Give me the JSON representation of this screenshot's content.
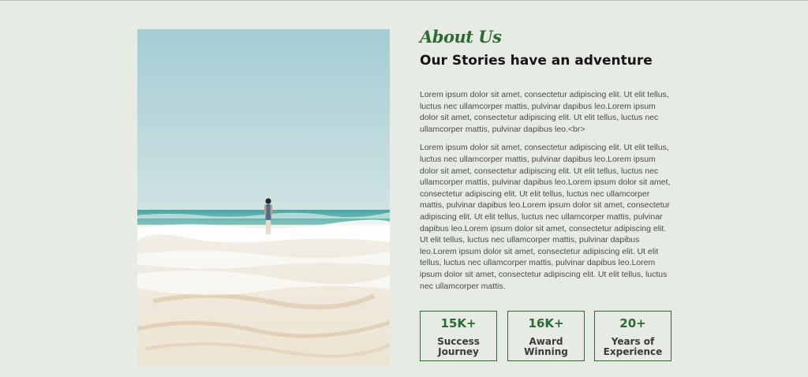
{
  "about": {
    "eyebrow": "About Us",
    "title": "Our Stories have an adventure",
    "paragraph_1": "Lorem ipsum dolor sit amet, consectetur adipiscing elit. Ut elit tellus, luctus nec ullamcorper mattis, pulvinar dapibus leo.Lorem ipsum dolor sit amet, consectetur adipiscing elit. Ut elit tellus, luctus nec ullamcorper mattis, pulvinar dapibus leo.<br>",
    "paragraph_2": "Lorem ipsum dolor sit amet, consectetur adipiscing elit. Ut elit tellus, luctus nec ullamcorper mattis, pulvinar dapibus leo.Lorem ipsum dolor sit amet, consectetur adipiscing elit. Ut elit tellus, luctus nec ullamcorper mattis, pulvinar dapibus leo.Lorem ipsum dolor sit amet, consectetur adipiscing elit. Ut elit tellus, luctus nec ullamcorper mattis, pulvinar dapibus leo.Lorem ipsum dolor sit amet, consectetur adipiscing elit. Ut elit tellus, luctus nec ullamcorper mattis, pulvinar dapibus leo.Lorem ipsum dolor sit amet, consectetur adipiscing elit. Ut elit tellus, luctus nec ullamcorper mattis, pulvinar dapibus leo.Lorem ipsum dolor sit amet, consectetur adipiscing elit. Ut elit tellus, luctus nec ullamcorper mattis, pulvinar dapibus leo.Lorem ipsum dolor sit amet, consectetur adipiscing elit. Ut elit tellus, luctus nec ullamcorper mattis."
  },
  "stats": [
    {
      "value": "15K+",
      "label": "Success Journey"
    },
    {
      "value": "16K+",
      "label": "Award Winning"
    },
    {
      "value": "20+",
      "label": "Years of Experience"
    }
  ],
  "colors": {
    "background": "#e6ebe4",
    "accent": "#2f6a34",
    "heading": "#151515",
    "body_text": "#4b4b4b"
  },
  "photo": {
    "subject": "beach-photo"
  }
}
